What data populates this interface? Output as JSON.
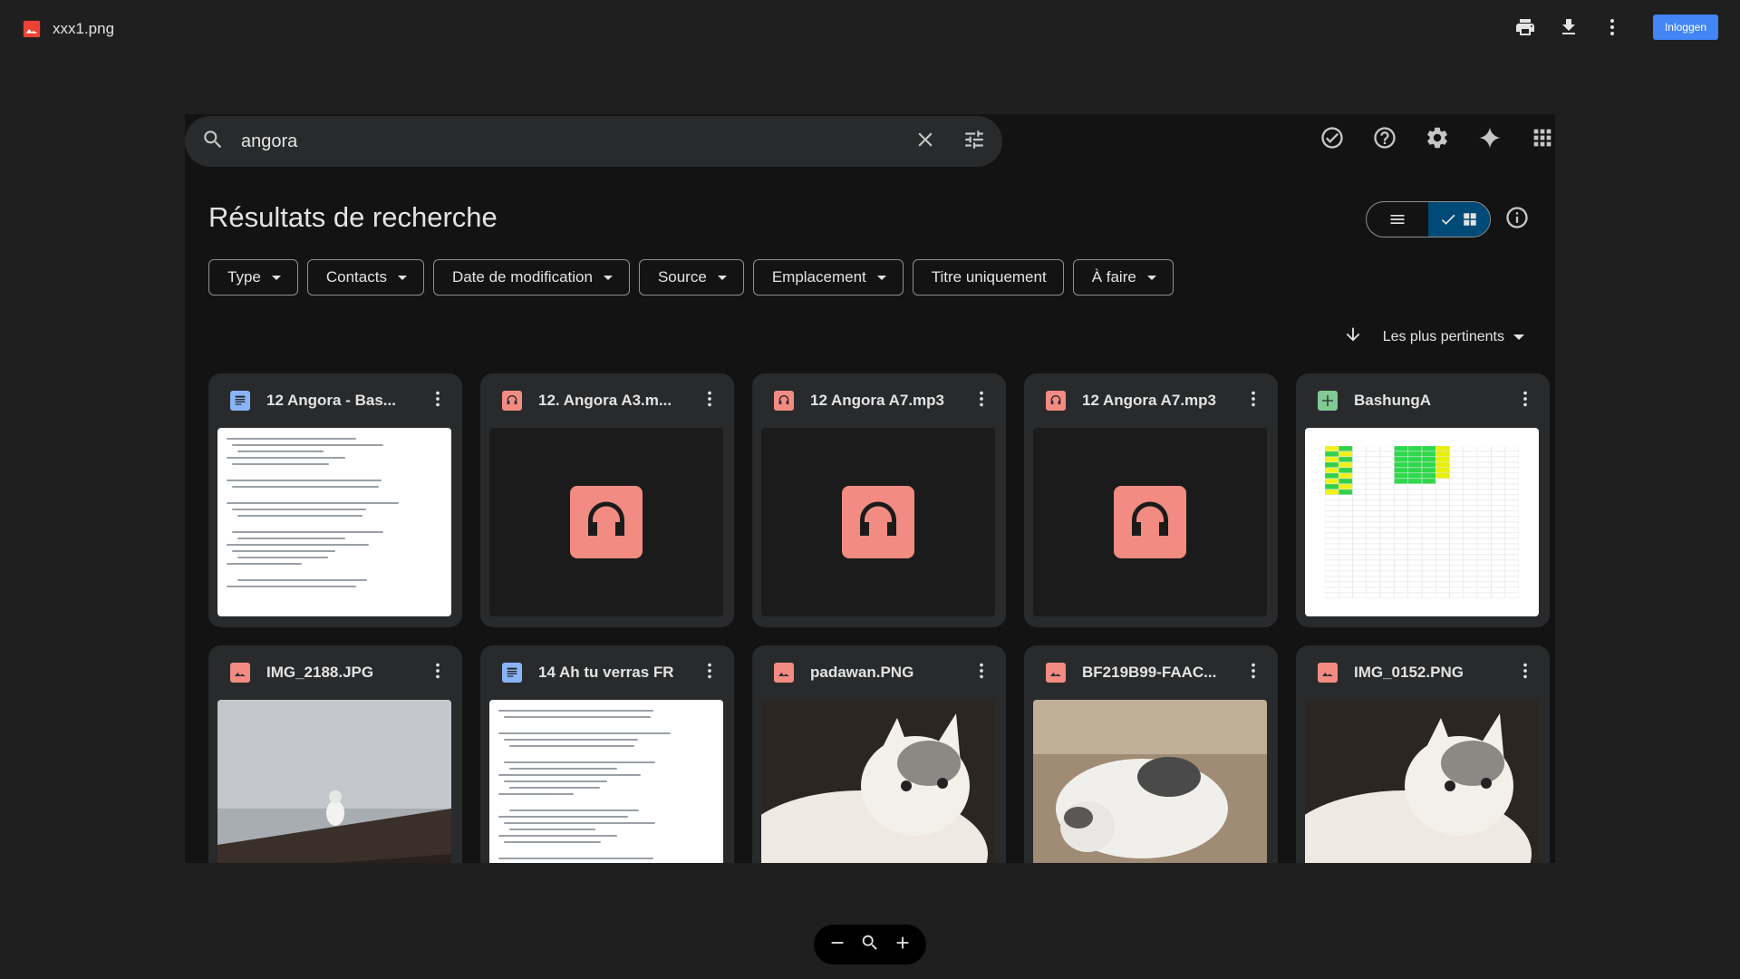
{
  "viewer": {
    "file_name": "xxx1.png",
    "login_label": "Inloggen"
  },
  "search": {
    "query": "angora"
  },
  "page_title": "Résultats de recherche",
  "filters": [
    {
      "label": "Type",
      "dropdown": true
    },
    {
      "label": "Contacts",
      "dropdown": true
    },
    {
      "label": "Date de modification",
      "dropdown": true
    },
    {
      "label": "Source",
      "dropdown": true
    },
    {
      "label": "Emplacement",
      "dropdown": true
    },
    {
      "label": "Titre uniquement",
      "dropdown": false
    },
    {
      "label": "À faire",
      "dropdown": true
    }
  ],
  "sort": {
    "label": "Les plus pertinents"
  },
  "files": [
    {
      "name": "12 Angora - Bas...",
      "type": "doc",
      "color": "#8ab4f8",
      "thumb": "doc"
    },
    {
      "name": "12. Angora A3.m...",
      "type": "audio",
      "color": "#f28b82",
      "thumb": "audio"
    },
    {
      "name": "12 Angora A7.mp3",
      "type": "audio",
      "color": "#f28b82",
      "thumb": "audio"
    },
    {
      "name": "12 Angora A7.mp3",
      "type": "audio",
      "color": "#f28b82",
      "thumb": "audio"
    },
    {
      "name": "BashungA",
      "type": "sheet",
      "color": "#81c995",
      "thumb": "sheet"
    },
    {
      "name": "IMG_2188.JPG",
      "type": "image",
      "color": "#f28b82",
      "thumb": "photo-roof"
    },
    {
      "name": "14 Ah tu verras FR",
      "type": "doc",
      "color": "#8ab4f8",
      "thumb": "doc"
    },
    {
      "name": "padawan.PNG",
      "type": "image",
      "color": "#f28b82",
      "thumb": "photo-kitten"
    },
    {
      "name": "BF219B99-FAAC...",
      "type": "image",
      "color": "#f28b82",
      "thumb": "photo-kitten2"
    },
    {
      "name": "IMG_0152.PNG",
      "type": "image",
      "color": "#f28b82",
      "thumb": "photo-kitten"
    }
  ]
}
